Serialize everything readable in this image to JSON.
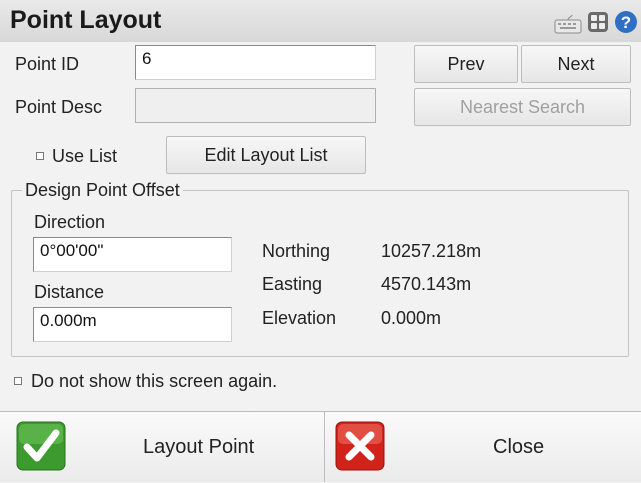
{
  "window": {
    "title": "Point Layout"
  },
  "toolbar_icons": [
    "keyboard-icon",
    "calculator-icon",
    "help-icon"
  ],
  "point_id": {
    "label": "Point ID",
    "value": "6"
  },
  "point_desc": {
    "label": "Point Desc",
    "value": ""
  },
  "nav": {
    "prev_label": "Prev",
    "next_label": "Next",
    "nearest_label": "Nearest Search"
  },
  "use_list": {
    "label": "Use List",
    "checked": false
  },
  "edit_layout_list_label": "Edit Layout List",
  "design_offset": {
    "legend": "Design Point Offset",
    "direction_label": "Direction",
    "direction_value": "0°00'00\"",
    "distance_label": "Distance",
    "distance_value": "0.000m"
  },
  "coords": {
    "northing_label": "Northing",
    "northing_value": "10257.218m",
    "easting_label": "Easting",
    "easting_value": "4570.143m",
    "elevation_label": "Elevation",
    "elevation_value": "0.000m"
  },
  "dont_show": {
    "label": "Do not show this screen again.",
    "checked": false
  },
  "actions": {
    "layout_label": "Layout Point",
    "close_label": "Close"
  },
  "colors": {
    "accent_green": "#3d9a2e",
    "accent_red": "#d2231b",
    "help_blue": "#2f6fc4"
  }
}
